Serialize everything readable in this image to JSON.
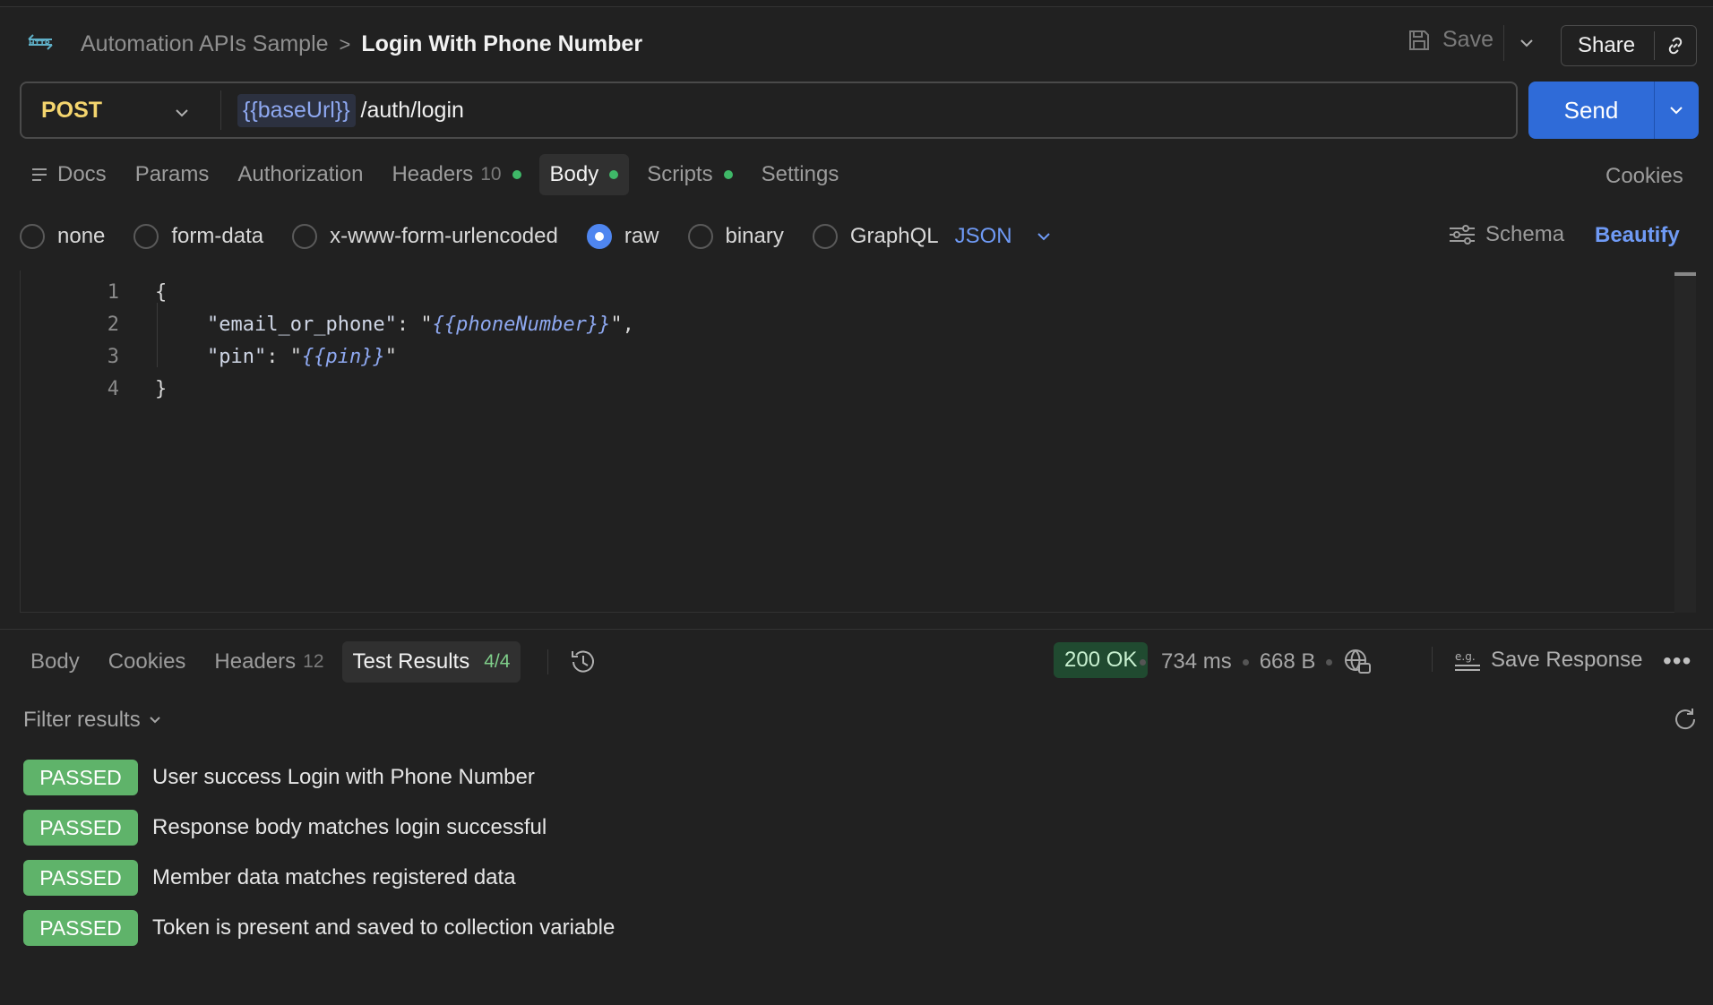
{
  "header": {
    "breadcrumb_parent": "Automation APIs Sample",
    "breadcrumb_sep": ">",
    "title": "Login With Phone Number",
    "save_label": "Save",
    "share_label": "Share"
  },
  "request": {
    "method": "POST",
    "url_variable": "{{baseUrl}}",
    "url_path": "/auth/login",
    "send_label": "Send"
  },
  "tabs": [
    {
      "label": "Docs"
    },
    {
      "label": "Params"
    },
    {
      "label": "Authorization"
    },
    {
      "label": "Headers",
      "count": "10"
    },
    {
      "label": "Body"
    },
    {
      "label": "Scripts"
    },
    {
      "label": "Settings"
    }
  ],
  "cookies_label": "Cookies",
  "body_types": {
    "none": "none",
    "form_data": "form-data",
    "urlencoded": "x-www-form-urlencoded",
    "raw": "raw",
    "binary": "binary",
    "graphql": "GraphQL",
    "selected_format": "JSON"
  },
  "schema_label": "Schema",
  "beautify_label": "Beautify",
  "editor": {
    "line_numbers": [
      "1",
      "2",
      "3",
      "4"
    ],
    "open_brace": "{",
    "key1": "\"email_or_phone\"",
    "val1": "{{phoneNumber}}",
    "key2": "\"pin\"",
    "val2": "{{pin}}",
    "close_brace": "}"
  },
  "response": {
    "tabs": [
      {
        "label": "Body"
      },
      {
        "label": "Cookies"
      },
      {
        "label": "Headers",
        "count": "12"
      },
      {
        "label": "Test Results",
        "count": "4/4"
      }
    ],
    "status": "200 OK",
    "time": "734 ms",
    "size": "668 B",
    "save_response_label": "Save Response",
    "filter_label": "Filter results"
  },
  "test_results": [
    {
      "status": "PASSED",
      "name": "User success Login with Phone Number"
    },
    {
      "status": "PASSED",
      "name": "Response body matches login successful"
    },
    {
      "status": "PASSED",
      "name": "Member data matches registered data"
    },
    {
      "status": "PASSED",
      "name": "Token is present and saved to collection variable"
    }
  ],
  "colors": {
    "background": "#212121",
    "method_post": "#f4d56e",
    "accent_blue": "#2f6bd8",
    "passed_green": "#5fb36a",
    "status_ok_bg": "#204a30"
  }
}
